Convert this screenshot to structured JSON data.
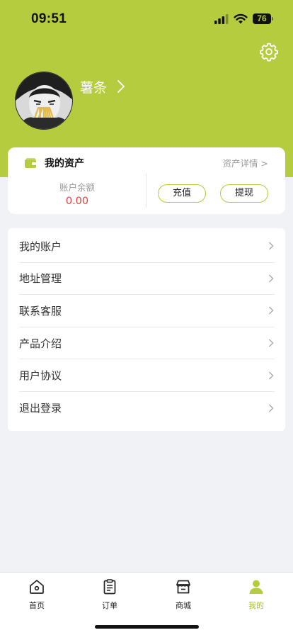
{
  "status_bar": {
    "time": "09:51",
    "battery": "76"
  },
  "profile": {
    "name": "薯条"
  },
  "assets": {
    "title": "我的资产",
    "detail_link": "资产详情 >",
    "balance_label": "账户余额",
    "balance_value": "0.00",
    "recharge_label": "充值",
    "withdraw_label": "提现"
  },
  "menu": {
    "items": [
      {
        "label": "我的账户"
      },
      {
        "label": "地址管理"
      },
      {
        "label": "联系客服"
      },
      {
        "label": "产品介绍"
      },
      {
        "label": "用户协议"
      },
      {
        "label": "退出登录"
      }
    ]
  },
  "tabbar": {
    "tabs": [
      {
        "label": "首页",
        "icon": "home-icon"
      },
      {
        "label": "订单",
        "icon": "clipboard-icon"
      },
      {
        "label": "商城",
        "icon": "store-icon"
      },
      {
        "label": "我的",
        "icon": "person-icon",
        "active": true
      }
    ]
  },
  "colors": {
    "accent": "#b6cc3f",
    "balance": "#e34040",
    "background": "#f1f2f6"
  }
}
